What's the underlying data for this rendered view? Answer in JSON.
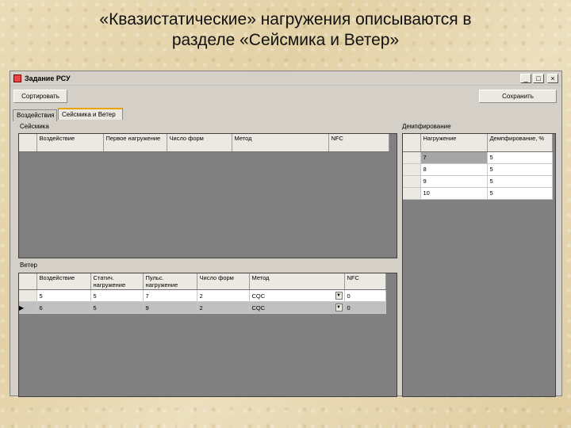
{
  "slide": {
    "title_line1": "«Квазистатические» нагружения описываются в",
    "title_line2": "разделе «Сейсмика и Ветер»"
  },
  "window": {
    "title": "Задание РСУ",
    "controls": {
      "minimize": "_",
      "maximize": "□",
      "close": "×"
    }
  },
  "toolbar": {
    "sort_label": "Сортировать",
    "save_label": "Сохранить"
  },
  "tabs": [
    {
      "label": "Воздействия"
    },
    {
      "label": "Сейсмика и Ветер"
    }
  ],
  "seismic": {
    "group_label": "Сейсмика",
    "columns": [
      "Воздействие",
      "Первое нагружение",
      "Число форм",
      "Метод",
      "NFC"
    ],
    "rows": []
  },
  "damping": {
    "group_label": "Демпфирование",
    "columns": [
      "Нагружение",
      "Демпфирование, %"
    ],
    "rows": [
      {
        "load": "7",
        "damping": "5"
      },
      {
        "load": "8",
        "damping": "5"
      },
      {
        "load": "9",
        "damping": "5"
      },
      {
        "load": "10",
        "damping": "5"
      }
    ]
  },
  "wind": {
    "group_label": "Ветер",
    "columns": [
      "Воздействие",
      "Статич. нагружение",
      "Пульс. нагружение",
      "Число форм",
      "Метод",
      "NFC"
    ],
    "rows": [
      {
        "action": "5",
        "static": "5",
        "pulse": "7",
        "forms": "2",
        "method": "CQC",
        "nfc": "0"
      },
      {
        "action": "6",
        "static": "5",
        "pulse": "9",
        "forms": "2",
        "method": "CQC",
        "nfc": "0"
      }
    ]
  },
  "icons": {
    "row_pointer": "current-row-pointer-icon",
    "dropdown": "dropdown-arrow-icon"
  }
}
